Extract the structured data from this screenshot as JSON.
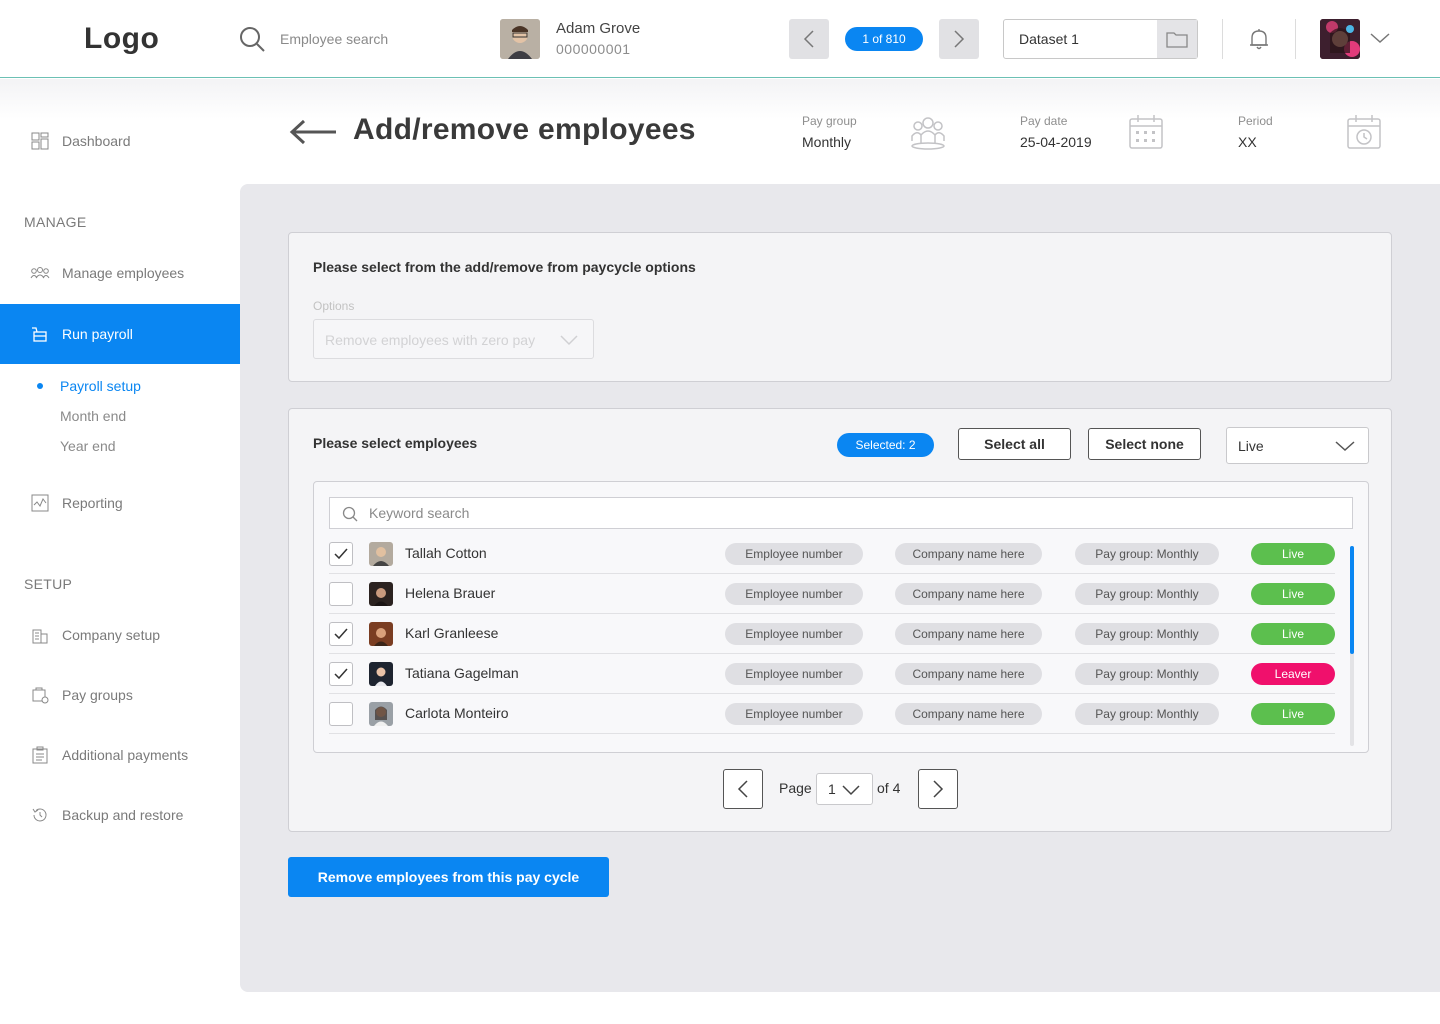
{
  "topbar": {
    "logo": "Logo",
    "search_placeholder": "Employee search",
    "employee_name": "Adam Grove",
    "employee_number": "000000001",
    "record_counter": "1 of 810",
    "dataset_value": "Dataset 1"
  },
  "sidebar": {
    "dashboard": "Dashboard",
    "manage_heading": "MANAGE",
    "manage_employees": "Manage employees",
    "run_payroll": "Run payroll",
    "sub_items": [
      "Payroll setup",
      "Month end",
      "Year end"
    ],
    "reporting": "Reporting",
    "setup_heading": "SETUP",
    "company_setup": "Company setup",
    "pay_groups": "Pay groups",
    "additional_payments": "Additional payments",
    "backup_restore": "Backup and restore"
  },
  "page": {
    "title": "Add/remove employees",
    "pay_group_label": "Pay group",
    "pay_group_value": "Monthly",
    "pay_date_label": "Pay date",
    "pay_date_value": "25-04-2019",
    "period_label": "Period",
    "period_value": "XX"
  },
  "options_card": {
    "title": "Please select from the add/remove from paycycle options",
    "options_label": "Options",
    "options_placeholder": "Remove employees with zero pay"
  },
  "employees_card": {
    "title": "Please select employees",
    "selected_badge": "Selected: 2",
    "select_all": "Select all",
    "select_none": "Select none",
    "status_filter": "Live",
    "keyword_placeholder": "Keyword search",
    "rows": [
      {
        "name": "Tallah Cotton",
        "checked": true,
        "emp_num": "Employee number",
        "company": "Company name here",
        "pay_group": "Pay group: Monthly",
        "status": "Live"
      },
      {
        "name": "Helena Brauer",
        "checked": false,
        "emp_num": "Employee number",
        "company": "Company name here",
        "pay_group": "Pay group: Monthly",
        "status": "Live"
      },
      {
        "name": "Karl Granleese",
        "checked": true,
        "emp_num": "Employee number",
        "company": "Company name here",
        "pay_group": "Pay group: Monthly",
        "status": "Live"
      },
      {
        "name": "Tatiana Gagelman",
        "checked": true,
        "emp_num": "Employee number",
        "company": "Company name here",
        "pay_group": "Pay group: Monthly",
        "status": "Leaver"
      },
      {
        "name": "Carlota Monteiro",
        "checked": false,
        "emp_num": "Employee number",
        "company": "Company name here",
        "pay_group": "Pay group: Monthly",
        "status": "Live"
      }
    ],
    "pager": {
      "page_label": "Page",
      "current_page": "1",
      "of_label": "of 4"
    }
  },
  "primary_action": "Remove employees from this pay cycle",
  "colors": {
    "accent": "#0a86f2",
    "live": "#5cbf4e",
    "leaver": "#f0106c"
  }
}
